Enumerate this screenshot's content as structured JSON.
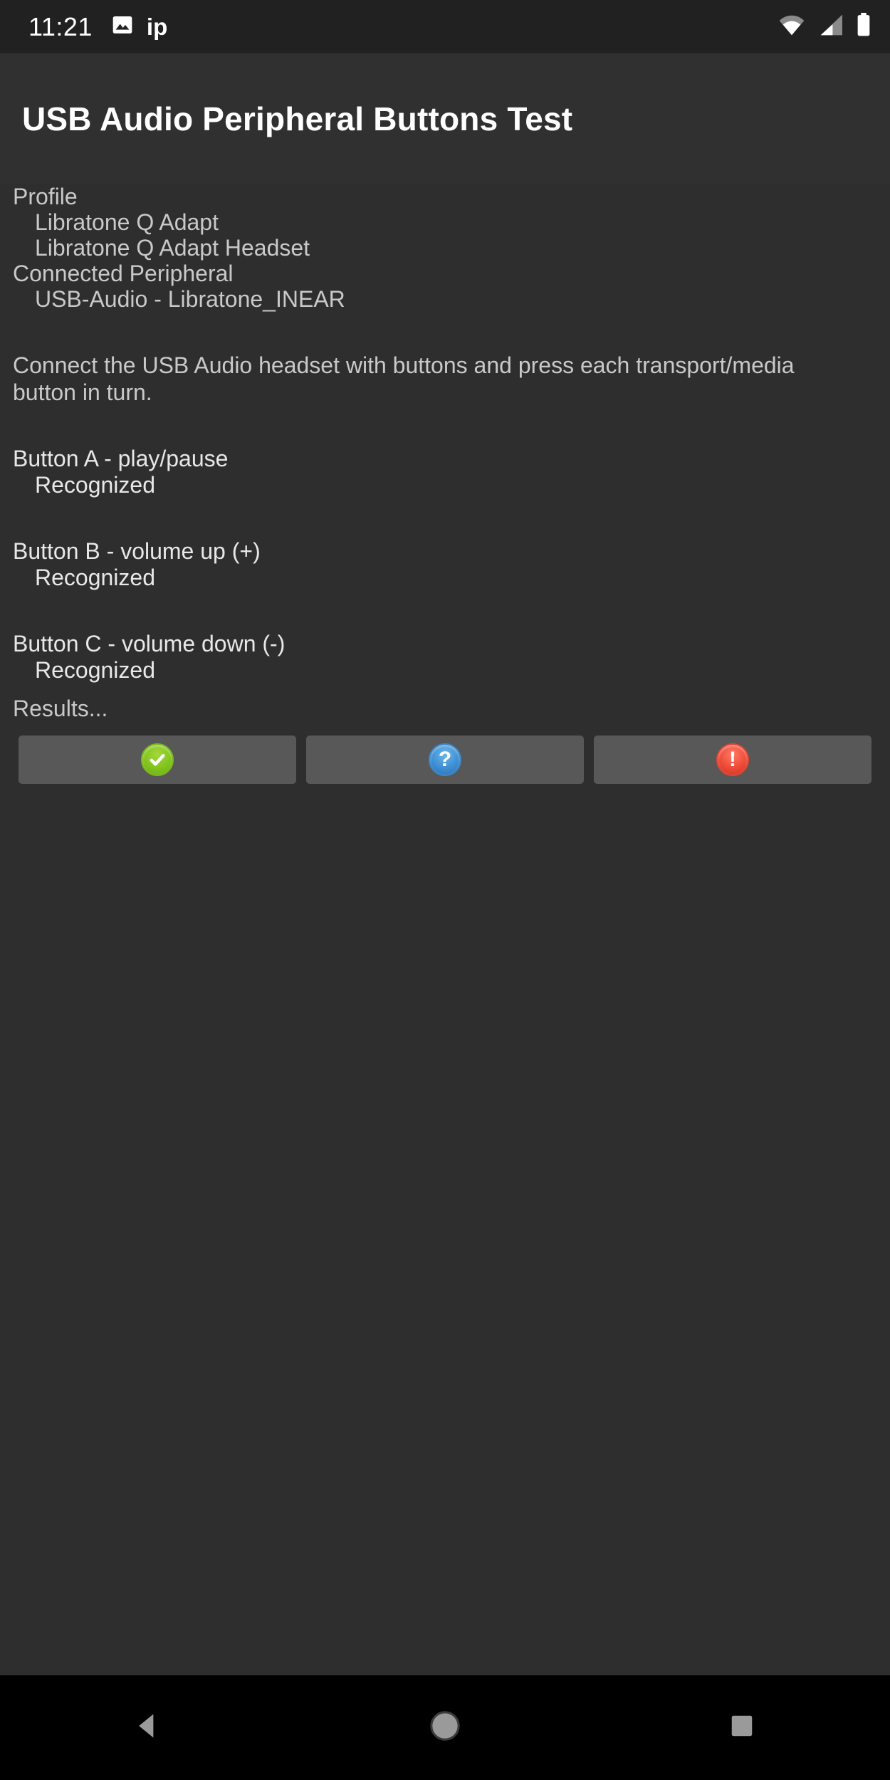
{
  "status_bar": {
    "time": "11:21",
    "notification_icon": "image-icon",
    "notification_text": "ip",
    "wifi_icon": "wifi-icon",
    "signal_icon": "cell-signal-icon",
    "battery_icon": "battery-full-icon"
  },
  "header": {
    "title": "USB Audio Peripheral Buttons Test"
  },
  "info": {
    "profile_label": "Profile",
    "profile_values": [
      "Libratone Q Adapt",
      "Libratone Q Adapt Headset"
    ],
    "connected_label": "Connected Peripheral",
    "connected_values": [
      "USB-Audio - Libratone_INEAR"
    ]
  },
  "instructions": {
    "text": "Connect the USB Audio headset with buttons and press each transport/media button in turn."
  },
  "buttons_test": [
    {
      "label": "Button A - play/pause",
      "status": "Recognized"
    },
    {
      "label": "Button B - volume up (+)",
      "status": "Recognized"
    },
    {
      "label": "Button C - volume down (-)",
      "status": "Recognized"
    }
  ],
  "results": {
    "label": "Results...",
    "actions": [
      {
        "name": "pass-button",
        "icon": "check-circle-icon",
        "color": "#84c520"
      },
      {
        "name": "info-button",
        "icon": "question-circle-icon",
        "color": "#3d8fd4"
      },
      {
        "name": "fail-button",
        "icon": "exclamation-circle-icon",
        "color": "#ee4b38"
      }
    ]
  },
  "nav_bar": {
    "back_icon": "back-triangle-icon",
    "home_icon": "home-circle-icon",
    "recents_icon": "recents-square-icon",
    "icon_color": "#9a9a9a"
  }
}
